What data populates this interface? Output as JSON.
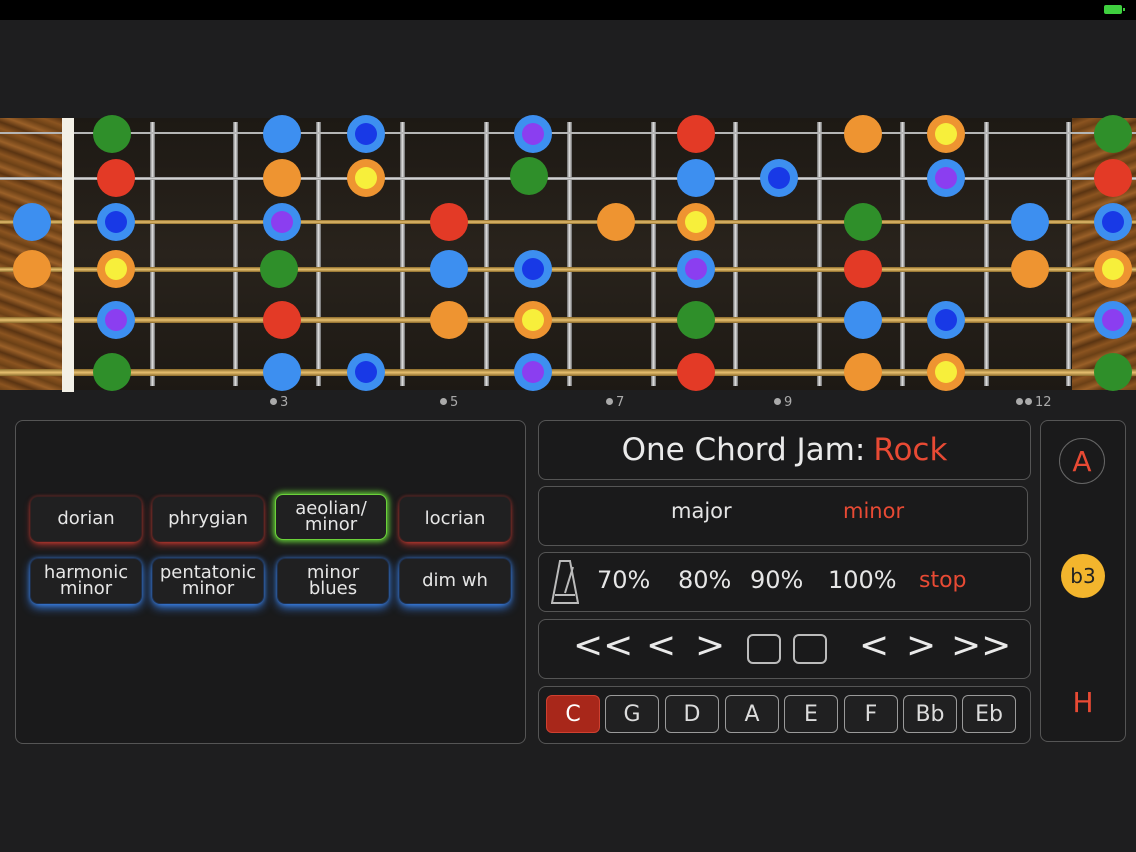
{
  "fretboard": {
    "fret_markers": [
      "3",
      "5",
      "7",
      "9",
      "12"
    ]
  },
  "scales": {
    "row1": [
      "dorian",
      "phrygian",
      "aeolian/ minor",
      "locrian"
    ],
    "row2": [
      "harmonic minor",
      "pentatonic minor",
      "minor blues",
      "dim wh"
    ]
  },
  "jam": {
    "prefix": "One Chord Jam:",
    "style": "Rock"
  },
  "mode": {
    "major": "major",
    "minor": "minor"
  },
  "tempo": {
    "options": [
      "70%",
      "80%",
      "90%",
      "100%"
    ],
    "stop": "stop"
  },
  "transport": {
    "first": "<<",
    "prev": "<",
    "next": ">",
    "prev2": "<",
    "next2": ">",
    "last": ">>"
  },
  "keys": {
    "items": [
      "C",
      "G",
      "D",
      "A",
      "E",
      "F",
      "Bb",
      "Eb"
    ],
    "selected": "C"
  },
  "side": {
    "top": "A",
    "mid": "b3",
    "bottom": "H"
  },
  "colors": {
    "accent": "#e84a34",
    "green": "#2f8f2a",
    "red": "#e33a26",
    "blue": "#3d8ff0",
    "orange": "#ee9431",
    "yellow": "#f7ef3b",
    "violet": "#8b3ef0",
    "darkblue": "#1839e6"
  }
}
